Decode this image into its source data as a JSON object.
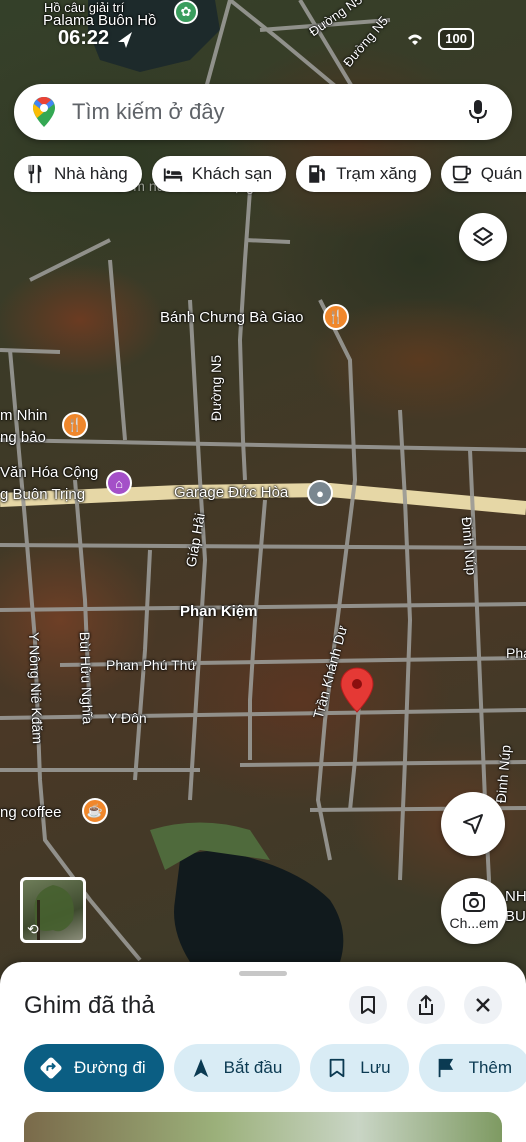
{
  "status_bar": {
    "time": "06:22",
    "battery": "100",
    "top_labels": [
      "Hồ câu giải trí",
      "Palama Buôn Hồ"
    ]
  },
  "search": {
    "placeholder": "Tìm kiếm ở đây"
  },
  "chips": [
    {
      "label": "Nhà hàng",
      "icon": "restaurant-icon"
    },
    {
      "label": "Khách sạn",
      "icon": "hotel-icon"
    },
    {
      "label": "Trạm xăng",
      "icon": "gas-station-icon"
    },
    {
      "label": "Quán c",
      "icon": "coffee-icon"
    }
  ],
  "map": {
    "places": {
      "banh_chung": "Bánh Chưng Bà Giao",
      "nhin_1": "m Nhin",
      "nhin_2": "ng bảo",
      "van_hoa_1": "Văn Hóa Cộng",
      "van_hoa_2": "g Buôn Trịng",
      "garage": "Garage Đức Hòa",
      "coffee": "ng coffee",
      "top_cut": "Cơm nước Buôn Trịng",
      "nh_1": "NH",
      "nh_2": "BU"
    },
    "streets": {
      "duong_n5_top1": "Đường N5",
      "duong_n5_top2": "Đường N5",
      "duong_n5": "Đường N5",
      "giap_hai": "Giáp Hải",
      "dinh_nup1": "Đinh Núp",
      "dinh_nup2": "Đinh Núp",
      "phan_kiem": "Phan Kiệm",
      "phan_phu_thu": "Phan Phú Thứ",
      "pha": "Pha",
      "y_don": "Y Đôn",
      "tran_khanh_du": "Trần Khánh Dư",
      "y_nong": "Y Nông Niê Kđăm",
      "bui_huu_nghia": "Bùi Hữu Nghĩa"
    }
  },
  "buttons": {
    "lens_label": "Ch...em"
  },
  "sheet": {
    "title": "Ghim đã thả",
    "actions": [
      {
        "label": "Đường đi",
        "icon": "directions-icon"
      },
      {
        "label": "Bắt đầu",
        "icon": "navigation-arrow-icon"
      },
      {
        "label": "Lưu",
        "icon": "bookmark-icon"
      },
      {
        "label": "Thêm",
        "icon": "flag-icon"
      }
    ]
  },
  "colors": {
    "primary_action": "#0b5e83",
    "secondary_action": "#d9ecf5",
    "pin": "#e53935",
    "poi_food": "#f0872b",
    "poi_museum": "#a450c8"
  }
}
